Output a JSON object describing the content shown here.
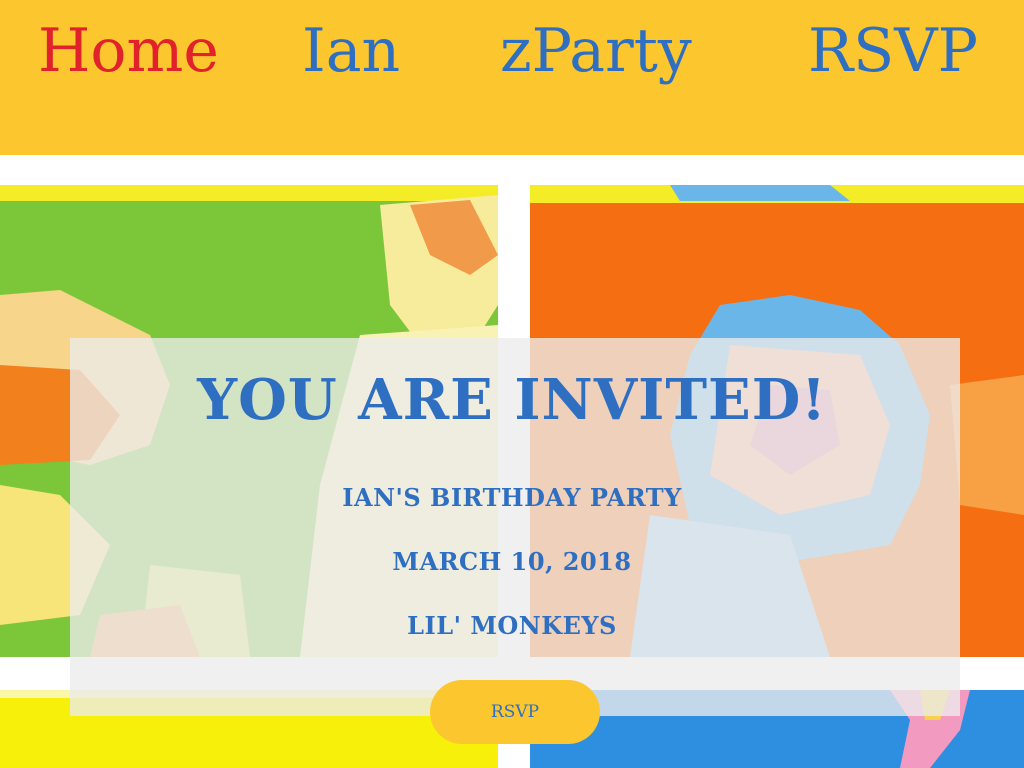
{
  "nav": {
    "items": [
      {
        "label": "Home",
        "active": true
      },
      {
        "label": "Ian",
        "active": false
      },
      {
        "label": "zParty",
        "active": false
      },
      {
        "label": "RSVP",
        "active": false
      }
    ]
  },
  "invite": {
    "title": "YOU ARE INVITED!",
    "party": "IAN'S BIRTHDAY PARTY",
    "date": "MARCH 10, 2018",
    "venue": "LIL' MONKEYS",
    "button_label": "RSVP"
  },
  "colors": {
    "nav_background": "#fcc62f",
    "link": "#2e6fc2",
    "active_link": "#e2222b",
    "title": "#2e6fc2",
    "button_background": "#fcc62f"
  }
}
